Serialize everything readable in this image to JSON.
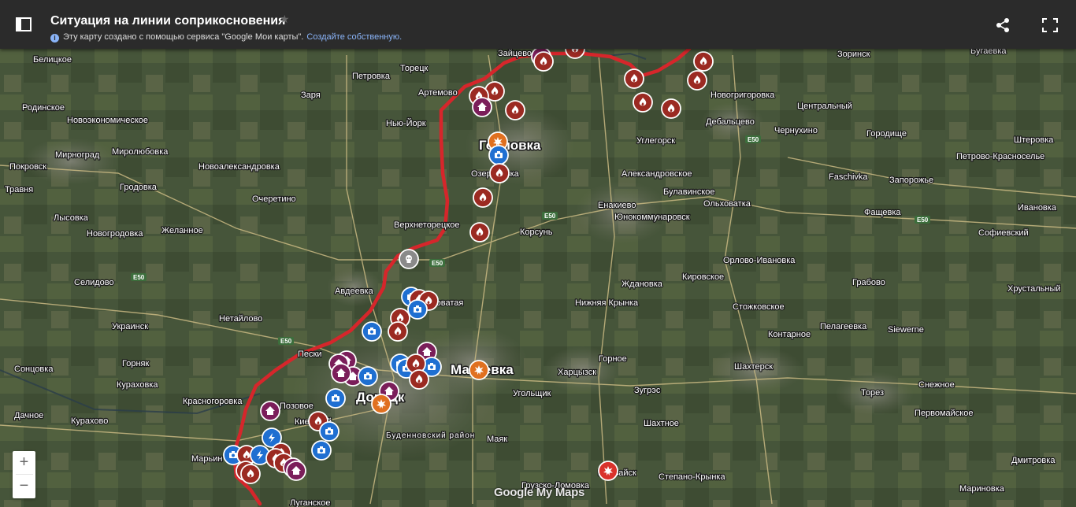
{
  "header": {
    "title": "Ситуация на линии соприкосновения",
    "star_symbol": "★",
    "info_text": "Эту карту создано с помощью сервиса \"Google Мои карты\".",
    "create_link": "Создайте собственную.",
    "info_icon_char": "i"
  },
  "map": {
    "front_line_color": "#d6262b",
    "places": [
      {
        "name": "Белицкое"
      },
      {
        "name": "Родинское"
      },
      {
        "name": "Новоэкономическое"
      },
      {
        "name": "Мирноград"
      },
      {
        "name": "Покровск"
      },
      {
        "name": "Миролюбовка"
      },
      {
        "name": "Новоалександровка"
      },
      {
        "name": "Гродовка"
      },
      {
        "name": "Очеретино"
      },
      {
        "name": "Лысовка"
      },
      {
        "name": "Новогродовка"
      },
      {
        "name": "Желанное"
      },
      {
        "name": "Селидово"
      },
      {
        "name": "Украинск"
      },
      {
        "name": "Нетайлово"
      },
      {
        "name": "Горняк"
      },
      {
        "name": "Сонцовка"
      },
      {
        "name": "Кураховка"
      },
      {
        "name": "Красногоровка"
      },
      {
        "name": "Дачное"
      },
      {
        "name": "Курахово"
      },
      {
        "name": "Марьин"
      },
      {
        "name": "Петровка"
      },
      {
        "name": "Торецк"
      },
      {
        "name": "Зайцево"
      },
      {
        "name": "Зоринск"
      },
      {
        "name": "Бугаевка"
      },
      {
        "name": "Заря"
      },
      {
        "name": "Артемово"
      },
      {
        "name": "Нью-Йорк"
      },
      {
        "name": "Горловка"
      },
      {
        "name": "Озеряновка"
      },
      {
        "name": "Верхнеторецкое"
      },
      {
        "name": "Корсунь"
      },
      {
        "name": "Авдеевка"
      },
      {
        "name": "Ясиноватая"
      },
      {
        "name": "Пески"
      },
      {
        "name": "Донецк"
      },
      {
        "name": "Макеевка"
      },
      {
        "name": "Позовое"
      },
      {
        "name": "Киевский"
      },
      {
        "name": "Буденновский район"
      },
      {
        "name": "Маяк"
      },
      {
        "name": "Угольщик"
      },
      {
        "name": "Харцызск"
      },
      {
        "name": "Зугрэс"
      },
      {
        "name": "Шахтное"
      },
      {
        "name": "Иловайск"
      },
      {
        "name": "Грузско-Ломовка"
      },
      {
        "name": "Степано-Крынка"
      },
      {
        "name": "Луганское"
      },
      {
        "name": "Новогригоровка"
      },
      {
        "name": "Центральный"
      },
      {
        "name": "Дебальцево"
      },
      {
        "name": "Чернухино"
      },
      {
        "name": "Городище"
      },
      {
        "name": "Углегорск"
      },
      {
        "name": "Штеровка"
      },
      {
        "name": "Петрово-Красноселье"
      },
      {
        "name": "Faschivka"
      },
      {
        "name": "Запорожье"
      },
      {
        "name": "Александровское"
      },
      {
        "name": "Булавинское"
      },
      {
        "name": "Енакиево"
      },
      {
        "name": "Ольховатка"
      },
      {
        "name": "Юнокоммунаровск"
      },
      {
        "name": "Фащевка"
      },
      {
        "name": "Ивановка"
      },
      {
        "name": "Софиевский"
      },
      {
        "name": "Орлово-Ивановка"
      },
      {
        "name": "Кировское"
      },
      {
        "name": "Ждановка"
      },
      {
        "name": "Грабово"
      },
      {
        "name": "Хрустальный"
      },
      {
        "name": "Нижняя Крынка"
      },
      {
        "name": "Стожковское"
      },
      {
        "name": "Пелагеевка"
      },
      {
        "name": "Siewerne"
      },
      {
        "name": "Контарное"
      },
      {
        "name": "Горное"
      },
      {
        "name": "Шахтерск"
      },
      {
        "name": "Торез"
      },
      {
        "name": "Снежное"
      },
      {
        "name": "Первомайское"
      },
      {
        "name": "Дмитровка"
      },
      {
        "name": "Мариновка"
      },
      {
        "name": "Травня"
      }
    ],
    "road_badges": [
      {
        "name": "E50"
      }
    ],
    "marker_types": [
      "fire",
      "house",
      "camera",
      "explosion",
      "skull",
      "lightning"
    ],
    "marker_colors": {
      "fire": "#9b2a22",
      "house": "#7b1e5a",
      "camera": "#1f6fd1",
      "explosion": "#e07020",
      "skull": "#8a8a8a",
      "lightning": "#1f6fd1"
    }
  },
  "zoom": {
    "in_label": "+",
    "out_label": "−"
  },
  "attribution": {
    "logo_text": "Google My Maps"
  }
}
